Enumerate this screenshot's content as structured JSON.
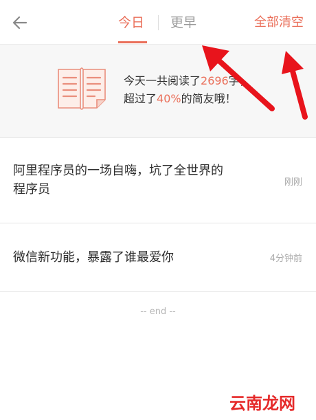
{
  "header": {
    "back_icon": "arrow-left-icon",
    "tabs": [
      {
        "label": "今日",
        "active": true
      },
      {
        "label": "更早",
        "active": false
      }
    ],
    "clear_all_label": "全部清空"
  },
  "summary": {
    "icon": "open-book-icon",
    "line1_prefix": "今天一共阅读了",
    "word_count": "2696",
    "line1_suffix": "字，",
    "line2_prefix": "超过了",
    "percent": "40%",
    "line2_suffix": "的简友哦！"
  },
  "articles": [
    {
      "title": "阿里程序员的一场自嗨，坑了全世界的程序员",
      "time": "刚刚"
    },
    {
      "title": "微信新功能，暴露了谁最爱你",
      "time": "4分钟前"
    }
  ],
  "end_text": "-- end --",
  "watermark": "云南龙网",
  "colors": {
    "accent": "#ea6f5a",
    "annotation_arrow": "#e8141c"
  }
}
